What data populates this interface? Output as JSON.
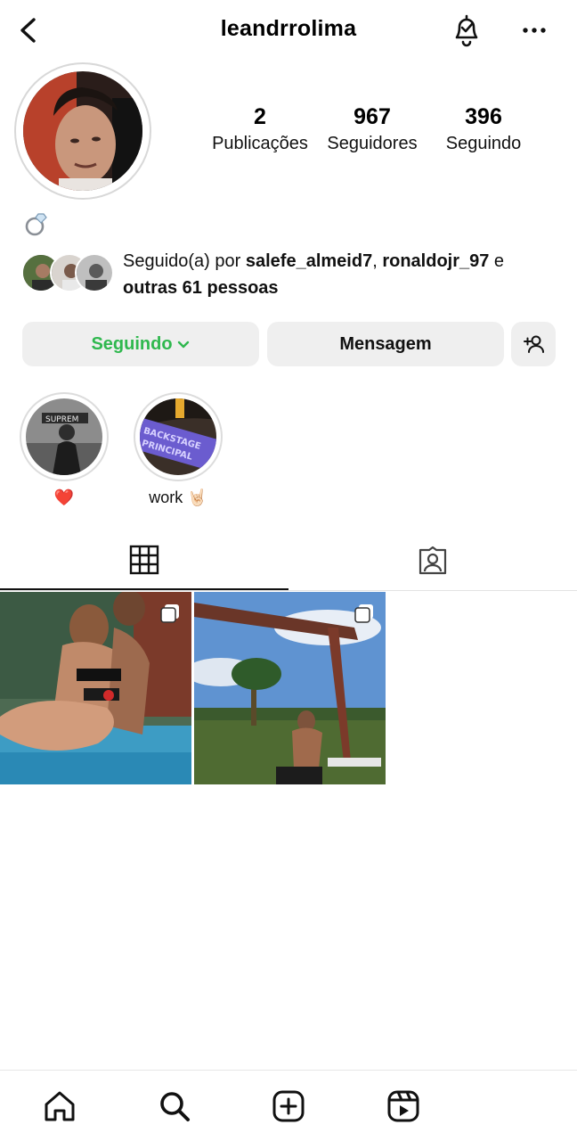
{
  "header": {
    "username": "leandrrolima",
    "icons": [
      "chevron-left-icon",
      "bell-check-icon",
      "more-horizontal-icon"
    ]
  },
  "profile": {
    "bio_emoji": "💍",
    "stats": {
      "posts": {
        "value": "2",
        "label": "Publicações"
      },
      "followers": {
        "value": "967",
        "label": "Seguidores"
      },
      "following": {
        "value": "396",
        "label": "Seguindo"
      }
    }
  },
  "followed_by": {
    "prefix": "Seguido(a) por ",
    "user1": "salefe_almeid7",
    "sep": ", ",
    "user2": "ronaldojr_97",
    "conj": " e",
    "others": "outras 61 pessoas"
  },
  "actions": {
    "following": "Seguindo",
    "message": "Mensagem"
  },
  "highlights": [
    {
      "label": "❤️"
    },
    {
      "label": "work 🤘🏻"
    }
  ],
  "tabs": [
    "grid-icon",
    "tagged-icon"
  ],
  "nav": [
    "home-icon",
    "search-icon",
    "create-icon",
    "reels-icon"
  ],
  "colors": {
    "accent_following": "#2fb84e",
    "button_bg": "#efefef"
  }
}
